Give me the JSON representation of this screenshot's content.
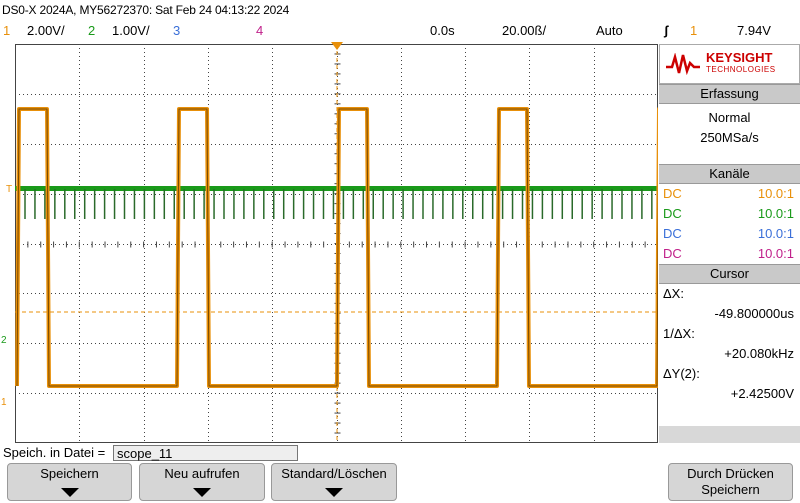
{
  "title": "DS0-X 2024A, MY56272370: Sat Feb 24 04:13:22 2024",
  "channels_bar": {
    "ch1_num": "1",
    "ch1_scale": "2.00V/",
    "ch2_num": "2",
    "ch2_scale": "1.00V/",
    "ch3_num": "3",
    "ch4_num": "4",
    "time_offset": "0.0s",
    "time_scale": "20.00ß/",
    "trigger_mode": "Auto",
    "trigger_symbol": "ʃ",
    "trigger_source": "1",
    "trigger_level": "7.94V"
  },
  "markers": {
    "trigger_T": "T",
    "ch2": "2",
    "ch1": "1"
  },
  "colors": {
    "ch1": "#e8900a",
    "ch2": "#1a9a1a",
    "ch3": "#3a6fd8",
    "ch4": "#c0208a",
    "grid": "#444444"
  },
  "side": {
    "logo_name": "KEYSIGHT",
    "logo_sub": "TECHNOLOGIES",
    "acq_title": "Erfassung",
    "acq_mode": "Normal",
    "acq_rate": "250MSa/s",
    "chan_title": "Kanäle",
    "chans": [
      {
        "coupling": "DC",
        "probe": "10.0:1"
      },
      {
        "coupling": "DC",
        "probe": "10.0:1"
      },
      {
        "coupling": "DC",
        "probe": "10.0:1"
      },
      {
        "coupling": "DC",
        "probe": "10.0:1"
      }
    ],
    "cursor_title": "Cursor",
    "dx_label": "ΔX:",
    "dx_value": "-49.800000us",
    "inv_dx_label": "1/ΔX:",
    "inv_dx_value": "+20.080kHz",
    "dy_label": "ΔY(2):",
    "dy_value": "+2.42500V"
  },
  "save": {
    "label": "Speich. in Datei =",
    "filename": "scope_11"
  },
  "softkeys": {
    "save": "Speichern",
    "recall": "Neu aufrufen",
    "default": "Standard/Löschen",
    "press_line1": "Durch Drücken",
    "press_line2": "Speichern"
  }
}
